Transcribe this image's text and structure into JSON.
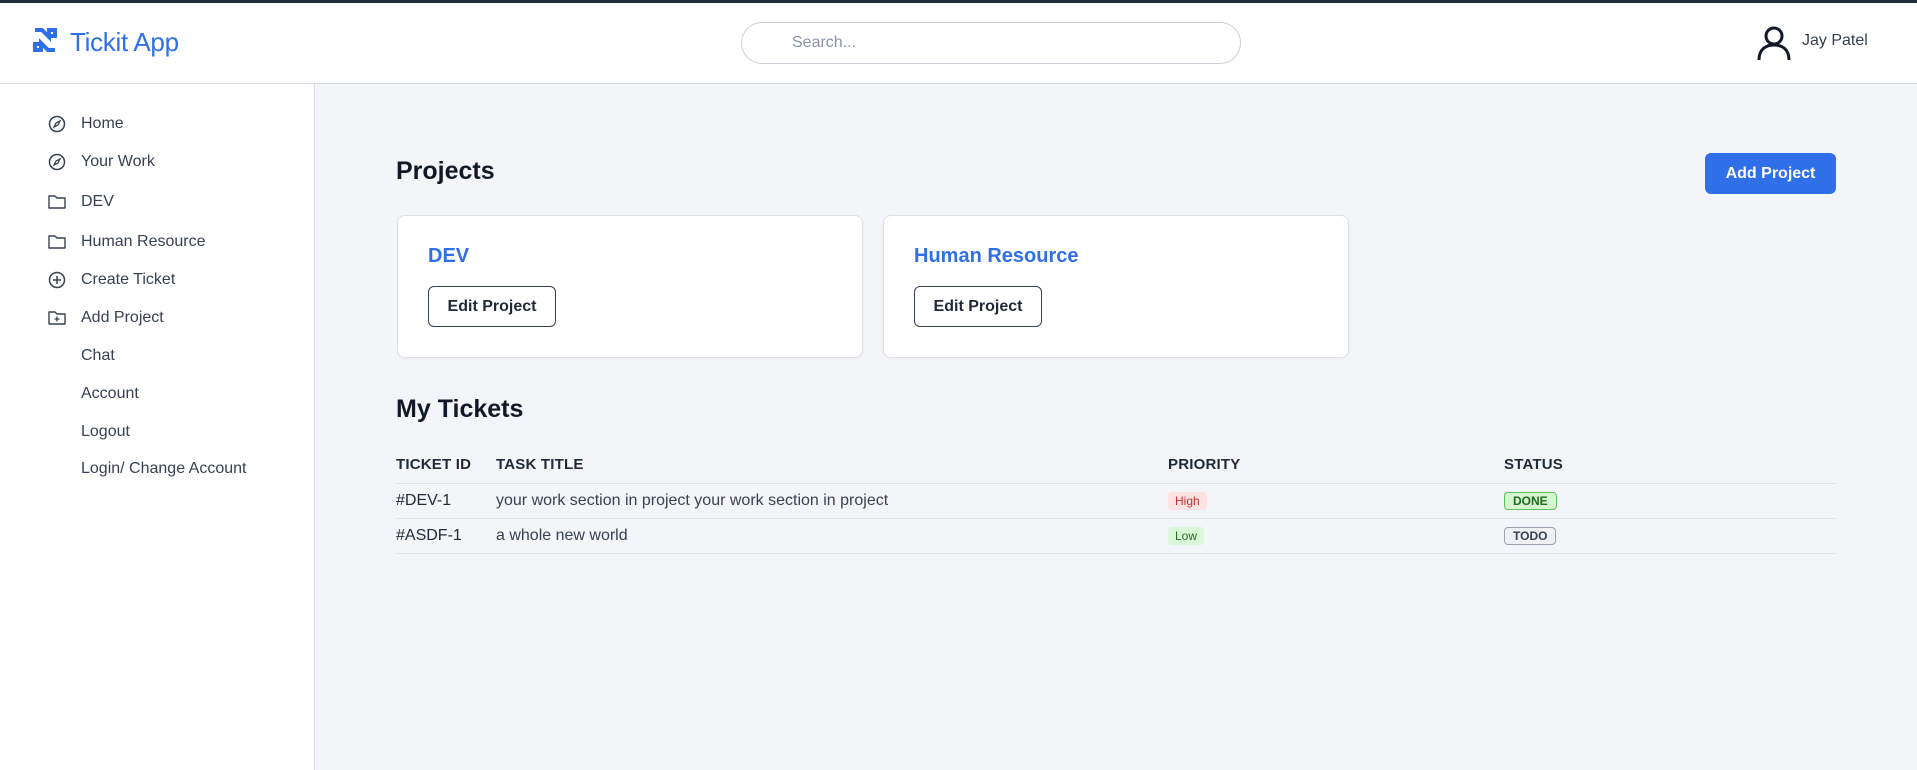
{
  "app": {
    "title": "Tickit App",
    "logo_icon": "tickit-logo-icon",
    "accent": "#2f6fe8"
  },
  "search": {
    "placeholder": "Search...",
    "value": ""
  },
  "user": {
    "name": "Jay Patel",
    "icon": "user-icon"
  },
  "sidebar": {
    "items": [
      {
        "label": "Home",
        "icon": "compass-icon"
      },
      {
        "label": "Your Work",
        "icon": "compass-icon"
      },
      {
        "label": "DEV",
        "icon": "folder-icon"
      },
      {
        "label": "Human Resource",
        "icon": "folder-icon"
      },
      {
        "label": "Create Ticket",
        "icon": "plus-circle-icon"
      },
      {
        "label": "Add Project",
        "icon": "folder-plus-icon"
      },
      {
        "label": "Chat"
      },
      {
        "label": "Account"
      },
      {
        "label": "Logout"
      },
      {
        "label": "Login/ Change Account"
      }
    ]
  },
  "projects": {
    "title": "Projects",
    "add_label": "Add Project",
    "cards": [
      {
        "name": "DEV",
        "edit_label": "Edit Project"
      },
      {
        "name": "Human Resource",
        "edit_label": "Edit Project"
      }
    ]
  },
  "tickets": {
    "title": "My Tickets",
    "columns": [
      "TICKET ID",
      "TASK TITLE",
      "PRIORITY",
      "STATUS"
    ],
    "rows": [
      {
        "id": "#DEV-1",
        "title": "your work section in project your work section in project",
        "priority": "High",
        "status": "DONE"
      },
      {
        "id": "#ASDF-1",
        "title": "a whole new world",
        "priority": "Low",
        "status": "TODO"
      }
    ]
  }
}
